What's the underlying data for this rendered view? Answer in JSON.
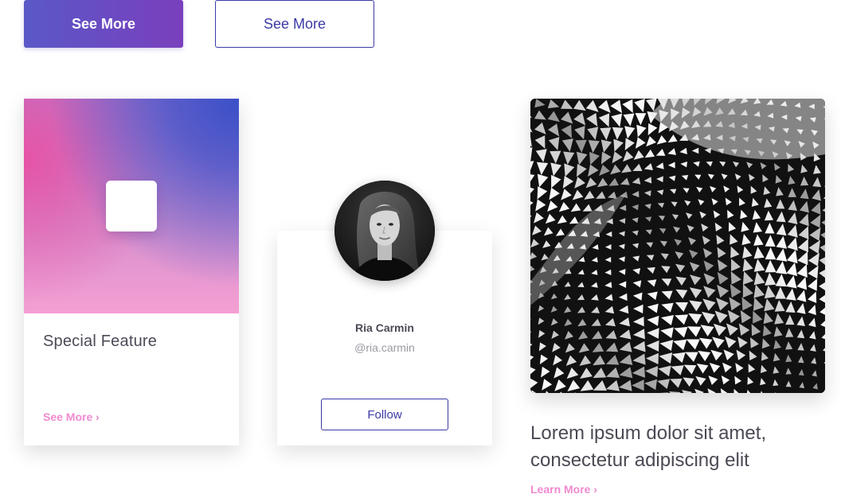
{
  "buttons": {
    "primary_label": "See More",
    "secondary_label": "See More"
  },
  "feature_card": {
    "title": "Special Feature",
    "link": "See More ›"
  },
  "profile_card": {
    "name": "Ria Carmin",
    "handle": "@ria.carmin",
    "follow_label": "Follow"
  },
  "article": {
    "title": "Lorem ipsum dolor sit amet, consectetur adipiscing elit",
    "link": "Learn More ›"
  },
  "colors": {
    "accent_blue": "#3a3aa6",
    "accent_purple": "#7a3fbd",
    "accent_pink": "#f08ad0"
  }
}
